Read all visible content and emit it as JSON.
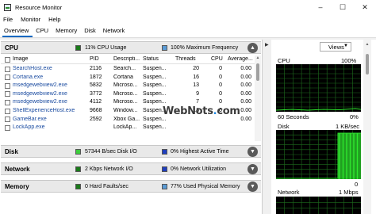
{
  "window": {
    "title": "Resource Monitor",
    "minimize_glyph": "–",
    "maximize_glyph": "☐",
    "close_glyph": "✕"
  },
  "menu": [
    "File",
    "Monitor",
    "Help"
  ],
  "tabs": [
    "Overview",
    "CPU",
    "Memory",
    "Disk",
    "Network"
  ],
  "sections": {
    "cpu": {
      "name": "CPU",
      "ind1_color": "#1a7a1a",
      "ind1_text": "11% CPU Usage",
      "ind2_color": "#5b9bd5",
      "ind2_text": "100% Maximum Frequency",
      "collapse_glyph": "▲"
    },
    "disk": {
      "name": "Disk",
      "ind1_color": "#3dcc3d",
      "ind1_text": "57344 B/sec Disk I/O",
      "ind2_color": "#1f3fbf",
      "ind2_text": "0% Highest Active Time",
      "collapse_glyph": "▼"
    },
    "network": {
      "name": "Network",
      "ind1_color": "#1a7a1a",
      "ind1_text": "2 Kbps Network I/O",
      "ind2_color": "#1f3fbf",
      "ind2_text": "0% Network Utilization",
      "collapse_glyph": "▼"
    },
    "memory": {
      "name": "Memory",
      "ind1_color": "#1a7a1a",
      "ind1_text": "0 Hard Faults/sec",
      "ind2_color": "#5b9bd5",
      "ind2_text": "77% Used Physical Memory",
      "collapse_glyph": "▼"
    }
  },
  "cpu_table": {
    "columns": [
      "Image",
      "PID",
      "Descripti...",
      "Status",
      "Threads",
      "CPU",
      "Average..."
    ],
    "rows": [
      [
        "SearchHost.exe",
        "2116",
        "Search...",
        "Suspen...",
        "20",
        "0",
        "0.00"
      ],
      [
        "Cortana.exe",
        "1872",
        "Cortana",
        "Suspen...",
        "16",
        "0",
        "0.00"
      ],
      [
        "msedgewebview2.exe",
        "5832",
        "Microso...",
        "Suspen...",
        "13",
        "0",
        "0.00"
      ],
      [
        "msedgewebview2.exe",
        "3772",
        "Microso...",
        "Suspen...",
        "9",
        "0",
        "0.00"
      ],
      [
        "msedgewebview2.exe",
        "4112",
        "Microso...",
        "Suspen...",
        "7",
        "0",
        "0.00"
      ],
      [
        "ShellExperienceHost.exe",
        "9668",
        "Window...",
        "Suspen...",
        "13",
        "0",
        "0.00"
      ],
      [
        "GameBar.exe",
        "2592",
        "Xbox Ga...",
        "Suspen...",
        "",
        "",
        "0.00"
      ],
      [
        "LockApp.exe",
        "",
        "LockAp...",
        "Suspen...",
        "",
        "",
        ""
      ]
    ]
  },
  "watermark": {
    "pre": "WebNots",
    "dot": ".",
    "post": "com"
  },
  "right_panel": {
    "split_arrow": "▶",
    "views_label": "Views",
    "views_arrow": "▼",
    "scroll_up": "▲",
    "cpu": {
      "label": "CPU",
      "right": "100%",
      "bottom_left": "60 Seconds",
      "bottom_right": "0%"
    },
    "disk": {
      "label": "Disk",
      "right": "1 KB/sec",
      "bottom_right": "0"
    },
    "network": {
      "label": "Network",
      "right": "1 Mbps"
    },
    "graph_bg": "#000000",
    "grid_color": "#1d6b1d",
    "line_color": "#2ee82e",
    "fill_color": "#20a020"
  },
  "colors": {
    "accent": "#0067c0",
    "link": "#1a4ba0"
  }
}
